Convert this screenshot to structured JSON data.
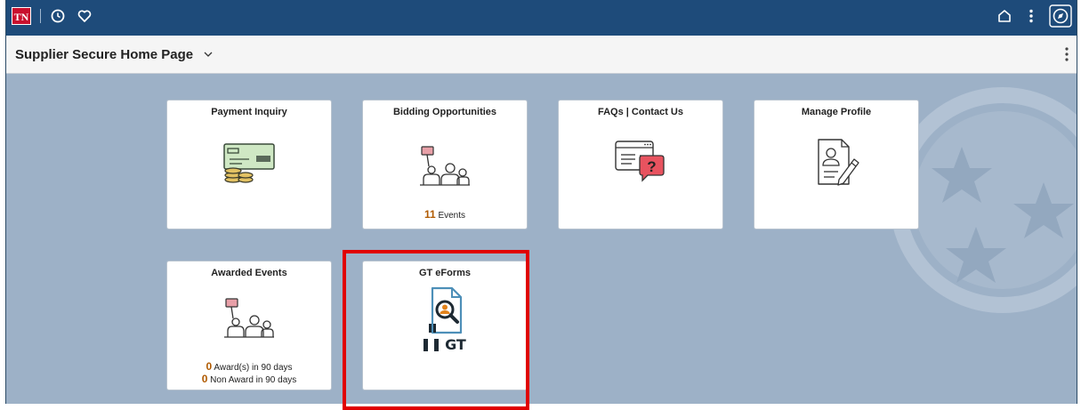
{
  "topbar": {
    "logo_text": "TN",
    "icons": [
      "recent-history-icon",
      "favorites-icon",
      "home-icon",
      "actions-menu-icon",
      "navbar-compass-icon"
    ]
  },
  "header": {
    "title": "Supplier Secure Home Page"
  },
  "tiles": [
    {
      "title": "Payment Inquiry",
      "icon": "check-with-coins-icon"
    },
    {
      "title": "Bidding Opportunities",
      "icon": "bidder-icon",
      "count_value": "11",
      "count_text": "Events"
    },
    {
      "title": "FAQs | Contact Us",
      "icon": "faq-window-icon"
    },
    {
      "title": "Manage Profile",
      "icon": "profile-edit-icon"
    },
    {
      "title": "Awarded Events",
      "icon": "bidder-icon",
      "lines": [
        {
          "value": "0",
          "text": "Award(s) in 90 days"
        },
        {
          "value": "0",
          "text": "Non Award in 90 days"
        }
      ]
    },
    {
      "title": "GT eForms",
      "icon": "gt-eforms-icon",
      "logo_text": "GT"
    }
  ],
  "colors": {
    "topbar": "#1e4b7a",
    "background": "#9db1c7",
    "count_accent": "#b05a00",
    "highlight": "#e00000"
  }
}
